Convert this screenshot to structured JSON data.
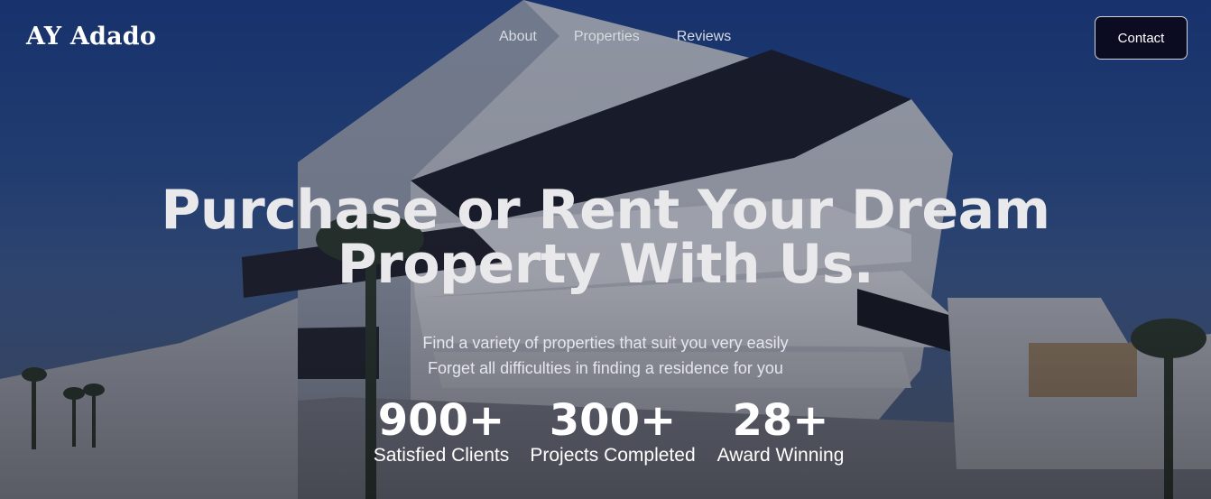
{
  "brand": {
    "logo": "AY Adado"
  },
  "nav": {
    "links": [
      {
        "label": "About"
      },
      {
        "label": "Properties"
      },
      {
        "label": "Reviews"
      }
    ],
    "contact_label": "Contact"
  },
  "hero": {
    "headline_line1": "Purchase or Rent Your Dream",
    "headline_line2": "Property With Us.",
    "sub_line1": "Find a variety of properties that suit you very easily",
    "sub_line2": "Forget all difficulties in finding a residence for you",
    "background_image": "modern white apartment building with balconies and palm trees under a blue sky"
  },
  "stats": [
    {
      "value": "900+",
      "label": "Satisfied Clients"
    },
    {
      "value": "300+",
      "label": "Projects Completed"
    },
    {
      "value": "28+",
      "label": "Award Winning"
    }
  ],
  "colors": {
    "sky": "#1d3f86",
    "contact_bg": "#0b0c22",
    "text": "#ffffff"
  }
}
